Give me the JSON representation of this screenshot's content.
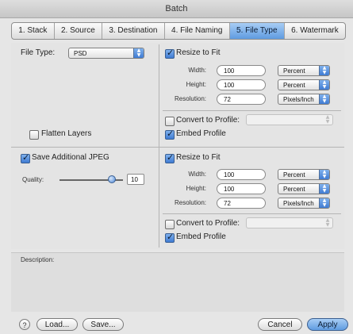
{
  "window": {
    "title": "Batch"
  },
  "tabs": [
    {
      "label": "1. Stack"
    },
    {
      "label": "2. Source"
    },
    {
      "label": "3. Destination"
    },
    {
      "label": "4. File Naming"
    },
    {
      "label": "5. File Type",
      "active": true
    },
    {
      "label": "6. Watermark"
    }
  ],
  "left_top": {
    "file_type_label": "File Type:",
    "file_type_value": "PSD",
    "flatten_label": "Flatten Layers",
    "flatten_checked": false
  },
  "right_top": {
    "resize_label": "Resize to Fit",
    "resize_checked": true,
    "width_label": "Width:",
    "width_value": "100",
    "width_unit": "Percent",
    "height_label": "Height:",
    "height_value": "100",
    "height_unit": "Percent",
    "resolution_label": "Resolution:",
    "resolution_value": "72",
    "resolution_unit": "Pixels/Inch",
    "convert_label": "Convert to Profile:",
    "convert_checked": false,
    "embed_label": "Embed Profile",
    "embed_checked": true
  },
  "left_bottom": {
    "save_jpeg_label": "Save Additional JPEG",
    "save_jpeg_checked": true,
    "quality_label": "Quality:",
    "quality_value": "10"
  },
  "right_bottom": {
    "resize_label": "Resize to Fit",
    "resize_checked": true,
    "width_label": "Width:",
    "width_value": "100",
    "width_unit": "Percent",
    "height_label": "Height:",
    "height_value": "100",
    "height_unit": "Percent",
    "resolution_label": "Resolution:",
    "resolution_value": "72",
    "resolution_unit": "Pixels/Inch",
    "convert_label": "Convert to Profile:",
    "convert_checked": false,
    "embed_label": "Embed Profile",
    "embed_checked": true
  },
  "description": {
    "label": "Description:"
  },
  "footer": {
    "help": "?",
    "load_label": "Load...",
    "save_label": "Save...",
    "cancel_label": "Cancel",
    "apply_label": "Apply"
  },
  "colors": {
    "accent": "#5f9be0",
    "window_bg": "#e4e4e4"
  }
}
